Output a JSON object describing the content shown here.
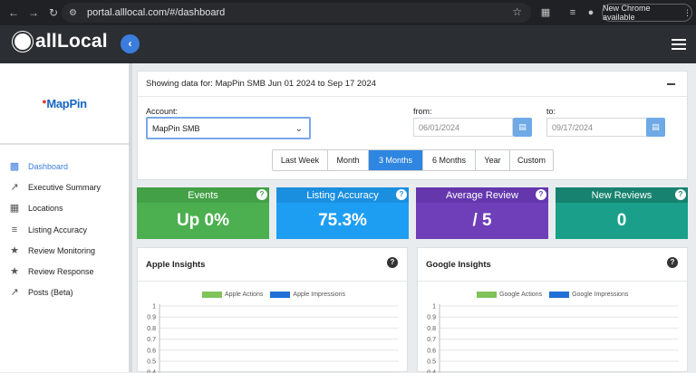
{
  "browser": {
    "url": "portal.alllocal.com/#/dashboard",
    "update_label": "New Chrome available"
  },
  "header": {
    "brand": "allLocal"
  },
  "sidebar": {
    "logo_text": "MapPin",
    "items": [
      {
        "label": "Dashboard",
        "icon": "dashboard-icon",
        "active": true
      },
      {
        "label": "Executive Summary",
        "icon": "trend-icon"
      },
      {
        "label": "Locations",
        "icon": "building-icon"
      },
      {
        "label": "Listing Accuracy",
        "icon": "list-icon"
      },
      {
        "label": "Review Monitoring",
        "icon": "star-icon"
      },
      {
        "label": "Review Response",
        "icon": "star-icon"
      },
      {
        "label": "Posts (Beta)",
        "icon": "trend-icon"
      }
    ]
  },
  "filters": {
    "summary": "Showing data for: MapPin SMB Jun 01 2024 to Sep 17 2024",
    "account_label": "Account:",
    "account_value": "MapPin SMB",
    "from_label": "from:",
    "from_value": "06/01/2024",
    "to_label": "to:",
    "to_value": "09/17/2024",
    "ranges": [
      "Last Week",
      "Month",
      "3 Months",
      "6 Months",
      "Year",
      "Custom"
    ],
    "active_range": "3 Months"
  },
  "cards": [
    {
      "title": "Events",
      "value": "Up 0%",
      "color": "#4caf50",
      "head_color": "#43a047"
    },
    {
      "title": "Listing Accuracy",
      "value": "75.3%",
      "color": "#1e9ef3",
      "head_color": "#1a8fe0"
    },
    {
      "title": "Average Review",
      "value": "/ 5",
      "color": "#6f3fb9",
      "head_color": "#6437ad"
    },
    {
      "title": "New Reviews",
      "value": "0",
      "color": "#1aa08a",
      "head_color": "#17826f"
    }
  ],
  "insights": [
    {
      "title": "Apple Insights",
      "legend": [
        "Apple Actions",
        "Apple Impressions"
      ]
    },
    {
      "title": "Google Insights",
      "legend": [
        "Google Actions",
        "Google Impressions"
      ]
    }
  ],
  "insight_colors": {
    "actions": "#7fc35a",
    "impressions": "#1f6fd6"
  },
  "axis_ticks": [
    "1",
    "0.9",
    "0.8",
    "0.7",
    "0.6",
    "0.5",
    "0.4"
  ]
}
